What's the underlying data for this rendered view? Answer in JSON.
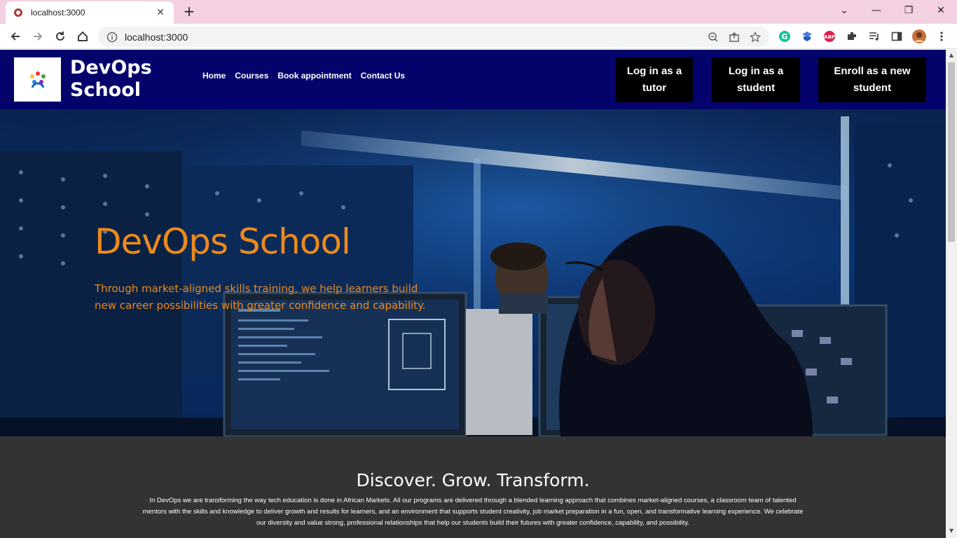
{
  "browser": {
    "tab_title": "localhost:3000",
    "tab_close": "✕",
    "new_tab": "+",
    "url": "localhost:3000",
    "window_controls": [
      "⌄",
      "—",
      "❐",
      "✕"
    ]
  },
  "site": {
    "brand": "DevOps School",
    "nav": [
      "Home",
      "Courses",
      "Book appointment",
      "Contact Us"
    ],
    "buttons": {
      "tutor_login": "Log in as a tutor",
      "student_login": "Log in as a student",
      "enroll": "Enroll as a new student"
    },
    "colors": {
      "header_bg": "#03036b",
      "accent": "#ec8a1c",
      "section_bg": "#333333"
    }
  },
  "hero": {
    "title": "DevOps School",
    "subtitle": "Through market-aligned skills training, we help learners build new career possibilities with greater confidence and capability."
  },
  "about": {
    "heading": "Discover. Grow. Transform.",
    "body": "In DevOps we are transforming the way tech education is done in African Markets. All our programs are delivered through a blended learning approach that combines market-aligned courses, a classroom team of talented mentors with the skills and knowledge to deliver growth and results for learners, and an environment that supports student creativity, job market preparation in a fun, open, and transformative learning experience. We celebrate our diversity and value strong, professional relationships that help our students build their futures with greater confidence, capability, and possibility."
  }
}
